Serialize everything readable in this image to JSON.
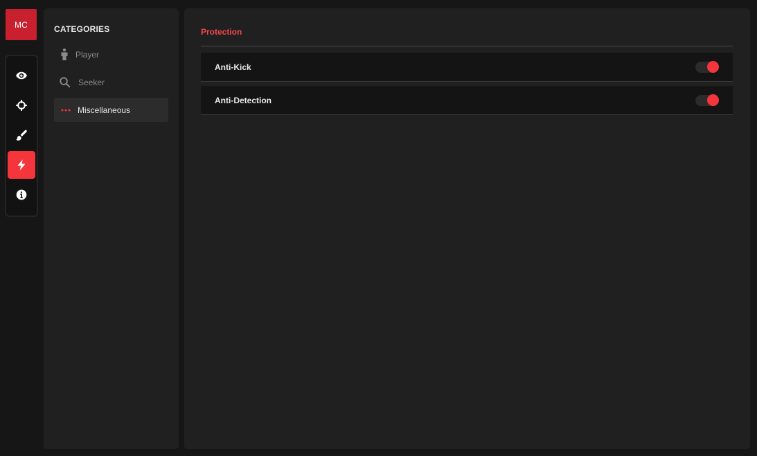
{
  "brand": {
    "logo_text": "MC",
    "accent_color": "#f4353b"
  },
  "rail": {
    "items": [
      {
        "icon": "eye-icon",
        "active": false
      },
      {
        "icon": "crosshair-icon",
        "active": false
      },
      {
        "icon": "brush-icon",
        "active": false
      },
      {
        "icon": "lightning-icon",
        "active": true
      },
      {
        "icon": "info-icon",
        "active": false
      }
    ]
  },
  "categories": {
    "title": "CATEGORIES",
    "items": [
      {
        "label": "Player",
        "icon": "person-icon",
        "active": false
      },
      {
        "label": "Seeker",
        "icon": "search-icon",
        "active": false
      },
      {
        "label": "Miscellaneous",
        "icon": "dots-icon",
        "active": true
      }
    ]
  },
  "main": {
    "section_title": "Protection",
    "options": [
      {
        "label": "Anti-Kick",
        "enabled": true
      },
      {
        "label": "Anti-Detection",
        "enabled": true
      }
    ]
  }
}
